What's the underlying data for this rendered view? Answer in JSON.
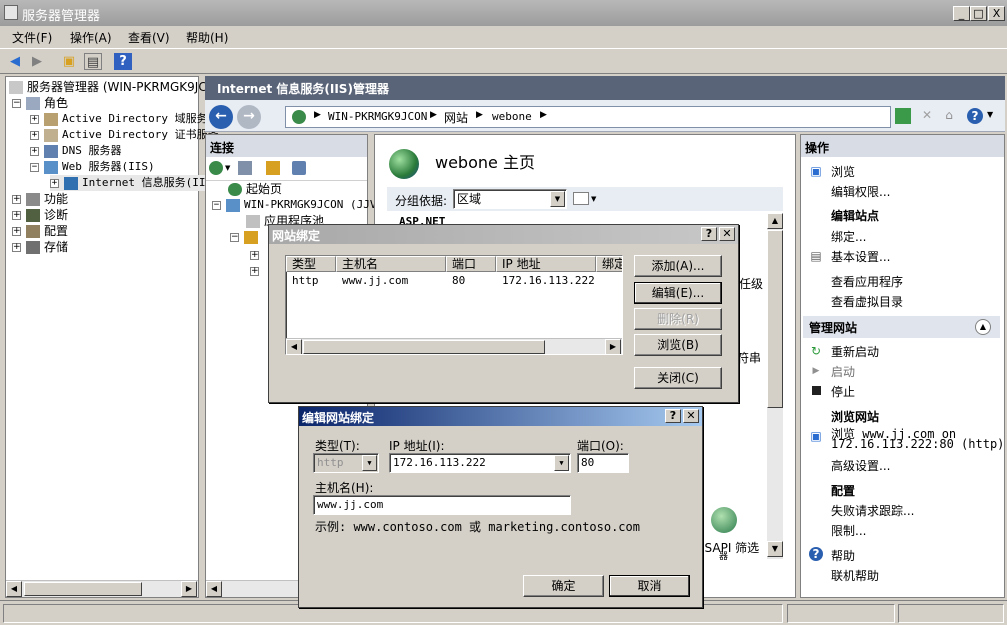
{
  "window": {
    "title": "服务器管理器",
    "controls": [
      "_",
      "□",
      "X"
    ]
  },
  "menubar": [
    "文件(F)",
    "操作(A)",
    "查看(V)",
    "帮助(H)"
  ],
  "tree": {
    "root": "服务器管理器 (WIN-PKRMGK9JCO",
    "roles": "角色",
    "ad_ds": "Active Directory 域服务",
    "ad_cs": "Active Directory 证书服务",
    "dns": "DNS 服务器",
    "web": "Web 服务器(IIS)",
    "iis": "Internet 信息服务(IIS)",
    "features": "功能",
    "diagnostics": "诊断",
    "config": "配置",
    "storage": "存储"
  },
  "iis": {
    "header": "Internet 信息服务(IIS)管理器",
    "breadcrumb": [
      "WIN-PKRMGK9JCON",
      "网站",
      "webone"
    ]
  },
  "connections": {
    "title": "连接",
    "start_page": "起始页",
    "server": "WIN-PKRMGK9JCON (JJV",
    "app_pools": "应用程序池"
  },
  "center": {
    "title": "webone 主页",
    "group_label": "分组依据:",
    "group_value": "区域",
    "aspnet": "ASP.NET",
    "frag1": "任级",
    "frag2": "符串",
    "isapi": "ISAPI 筛选",
    "isapi_sub": "器"
  },
  "actions": {
    "title": "操作",
    "browse": "浏览",
    "edit_perms": "编辑权限...",
    "edit_site_h": "编辑站点",
    "bindings": "绑定...",
    "basic_settings": "基本设置...",
    "view_apps": "查看应用程序",
    "view_vdirs": "查看虚拟目录",
    "manage_site_h": "管理网站",
    "restart": "重新启动",
    "start": "启动",
    "stop": "停止",
    "browse_site_h": "浏览网站",
    "browse_link_1": "浏览 www.jj.com on",
    "browse_link_2": "172.16.113.222:80 (http)",
    "advanced": "高级设置...",
    "config_h": "配置",
    "failed_trace": "失败请求跟踪...",
    "limits": "限制...",
    "help": "帮助",
    "online_help": "联机帮助"
  },
  "bindings_dialog": {
    "title": "网站绑定",
    "columns": [
      "类型",
      "主机名",
      "端口",
      "IP 地址",
      "绑定"
    ],
    "row": {
      "type": "http",
      "host": "www.jj.com",
      "port": "80",
      "ip": "172.16.113.222"
    },
    "add": "添加(A)...",
    "edit": "编辑(E)...",
    "remove": "删除(R)",
    "browse": "浏览(B)",
    "close": "关闭(C)"
  },
  "edit_dialog": {
    "title": "编辑网站绑定",
    "type_label": "类型(T):",
    "type_value": "http",
    "ip_label": "IP 地址(I):",
    "ip_value": "172.16.113.222",
    "port_label": "端口(O):",
    "port_value": "80",
    "host_label": "主机名(H):",
    "host_value": "www.jj.com",
    "example": "示例: www.contoso.com 或 marketing.contoso.com",
    "ok": "确定",
    "cancel": "取消"
  }
}
